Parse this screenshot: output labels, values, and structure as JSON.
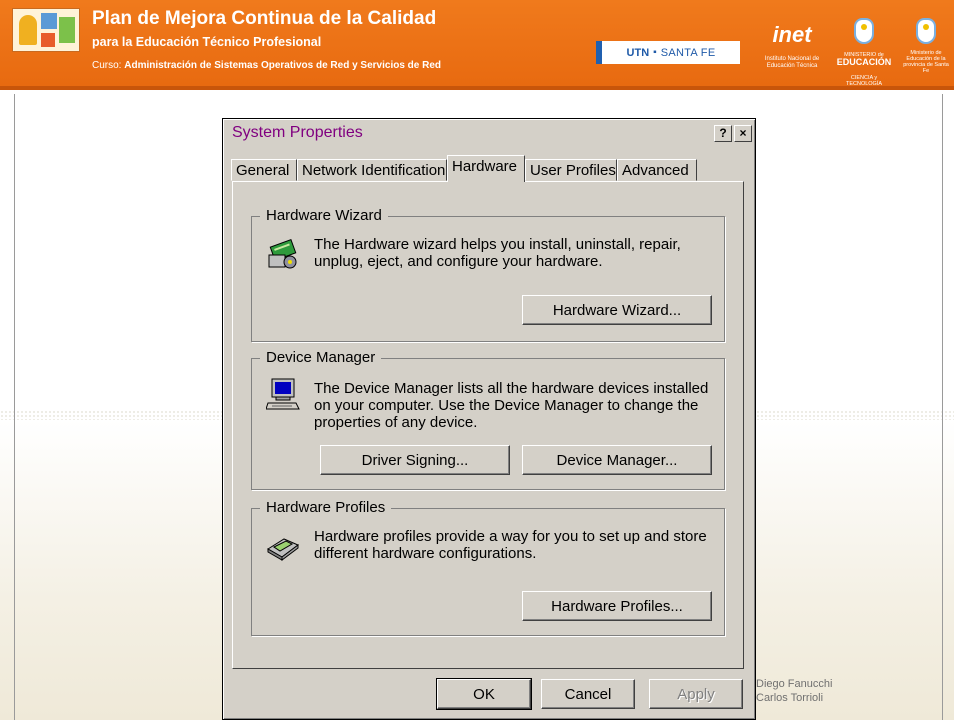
{
  "banner": {
    "title": "Plan de Mejora Continua de la Calidad",
    "subtitle": "para la Educación Técnico Profesional",
    "course_prefix": "Curso:",
    "course_name": "Administración de Sistemas Operativos de Red y Servicios de Red",
    "utn_left": "UTN",
    "utn_right": "SANTA FE",
    "inet_word": "inet",
    "inet_small": "Instituto Nacional de Educación Técnica",
    "min_small": "MINISTERIO de",
    "min_big": "EDUCACIÓN",
    "min_small2": "CIENCIA y TECNOLOGÍA",
    "santafe_small": "Ministerio de Educación de la provincia de Santa Fe"
  },
  "dialog": {
    "title": "System Properties",
    "help_button": "?",
    "close_button": "×",
    "tabs": [
      "General",
      "Network Identification",
      "Hardware",
      "User Profiles",
      "Advanced"
    ],
    "active_tab": "Hardware",
    "groups": {
      "wizard": {
        "label": "Hardware Wizard",
        "line1": "The Hardware wizard helps you install, uninstall, repair,",
        "line2": "unplug, eject, and configure your hardware.",
        "button": "Hardware Wizard..."
      },
      "device_manager": {
        "label": "Device Manager",
        "line1": "The Device Manager lists all the hardware devices installed",
        "line2": "on your computer.  Use the Device Manager to change the",
        "line3": "properties of any device.",
        "button_signing": "Driver Signing...",
        "button_manager": "Device Manager..."
      },
      "profiles": {
        "label": "Hardware Profiles",
        "line1": "Hardware profiles provide a way for you to set up and store",
        "line2": "different hardware configurations.",
        "button": "Hardware Profiles..."
      }
    },
    "footer": {
      "ok": "OK",
      "cancel": "Cancel",
      "apply": "Apply"
    }
  },
  "credits": {
    "line1": "Diego Fanucchi",
    "line2": "Carlos Torrioli"
  }
}
